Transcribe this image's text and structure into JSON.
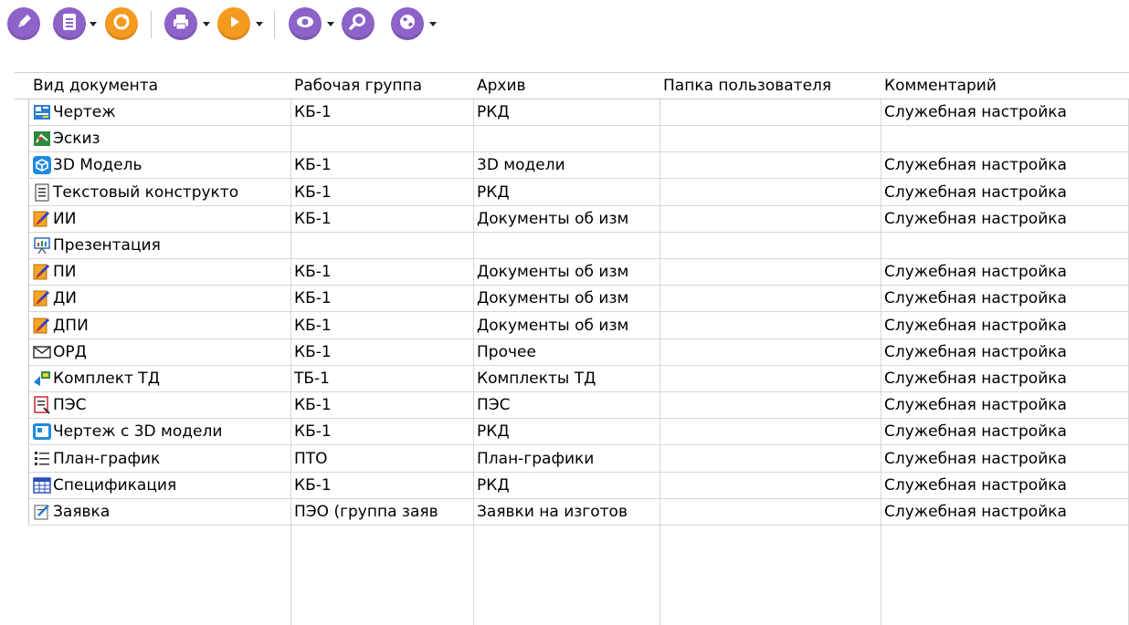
{
  "toolbar": {
    "buttons": [
      {
        "name": "edit-button",
        "icon": "pencil-icon",
        "color": "#8d62c9"
      },
      {
        "name": "document-button",
        "icon": "document-icon",
        "color": "#8d62c9",
        "dropdown": true
      },
      {
        "name": "refresh-button",
        "icon": "refresh-icon",
        "color": "#f59a1f"
      },
      {
        "name": "print-button",
        "icon": "printer-icon",
        "color": "#8d62c9",
        "dropdown": true
      },
      {
        "name": "play-button",
        "icon": "play-icon",
        "color": "#f59a1f",
        "dropdown": true
      },
      {
        "name": "view-button",
        "icon": "eye-icon",
        "color": "#8d62c9",
        "dropdown": true
      },
      {
        "name": "find-button",
        "icon": "magnifier-icon",
        "color": "#8d62c9"
      },
      {
        "name": "web-button",
        "icon": "globe-icon",
        "color": "#8d62c9",
        "dropdown": true
      }
    ]
  },
  "table": {
    "columns": [
      "Вид документа",
      "Рабочая группа",
      "Архив",
      "Папка пользователя",
      "Комментарий"
    ],
    "rows": [
      {
        "icon": "drawing-icon",
        "doc": "Чертеж",
        "group": "КБ-1",
        "archive": "РКД",
        "folder": "",
        "comment": "Служебная настройка"
      },
      {
        "icon": "sketch-icon",
        "doc": "Эскиз",
        "group": "",
        "archive": "",
        "folder": "",
        "comment": ""
      },
      {
        "icon": "cube-icon",
        "doc": "3D Модель",
        "group": "КБ-1",
        "archive": "3D модели",
        "folder": "",
        "comment": "Служебная настройка"
      },
      {
        "icon": "text-doc-icon",
        "doc": "Текстовый конструкто",
        "group": "КБ-1",
        "archive": "РКД",
        "folder": "",
        "comment": "Служебная настройка"
      },
      {
        "icon": "change-notice-icon",
        "doc": "ИИ",
        "group": "КБ-1",
        "archive": "Документы об изм",
        "folder": "",
        "comment": "Служебная настройка"
      },
      {
        "icon": "presentation-icon",
        "doc": "Презентация",
        "group": "",
        "archive": "",
        "folder": "",
        "comment": ""
      },
      {
        "icon": "change-notice-icon",
        "doc": "ПИ",
        "group": "КБ-1",
        "archive": "Документы об изм",
        "folder": "",
        "comment": "Служебная настройка"
      },
      {
        "icon": "change-notice-icon",
        "doc": "ДИ",
        "group": "КБ-1",
        "archive": "Документы об изм",
        "folder": "",
        "comment": "Служебная настройка"
      },
      {
        "icon": "change-notice-icon",
        "doc": "ДПИ",
        "group": "КБ-1",
        "archive": "Документы об изм",
        "folder": "",
        "comment": "Служебная настройка"
      },
      {
        "icon": "envelope-icon",
        "doc": "ОРД",
        "group": "КБ-1",
        "archive": "Прочее",
        "folder": "",
        "comment": "Служебная настройка"
      },
      {
        "icon": "tech-set-icon",
        "doc": "Комплект ТД",
        "group": "ТБ-1",
        "archive": "Комплекты ТД",
        "folder": "",
        "comment": "Служебная настройка"
      },
      {
        "icon": "pes-icon",
        "doc": "ПЭС",
        "group": "КБ-1",
        "archive": "ПЭС",
        "folder": "",
        "comment": "Служебная настройка"
      },
      {
        "icon": "drawing-3d-icon",
        "doc": "Чертеж с 3D модели",
        "group": "КБ-1",
        "archive": "РКД",
        "folder": "",
        "comment": "Служебная настройка"
      },
      {
        "icon": "schedule-icon",
        "doc": "План-график",
        "group": "ПТО",
        "archive": "План-графики",
        "folder": "",
        "comment": "Служебная настройка"
      },
      {
        "icon": "specification-icon",
        "doc": "Спецификация",
        "group": "КБ-1",
        "archive": "РКД",
        "folder": "",
        "comment": "Служебная настройка"
      },
      {
        "icon": "request-icon",
        "doc": "Заявка",
        "group": "ПЭО (группа заяв",
        "archive": "Заявки на изготов",
        "folder": "",
        "comment": "Служебная настройка"
      }
    ]
  }
}
